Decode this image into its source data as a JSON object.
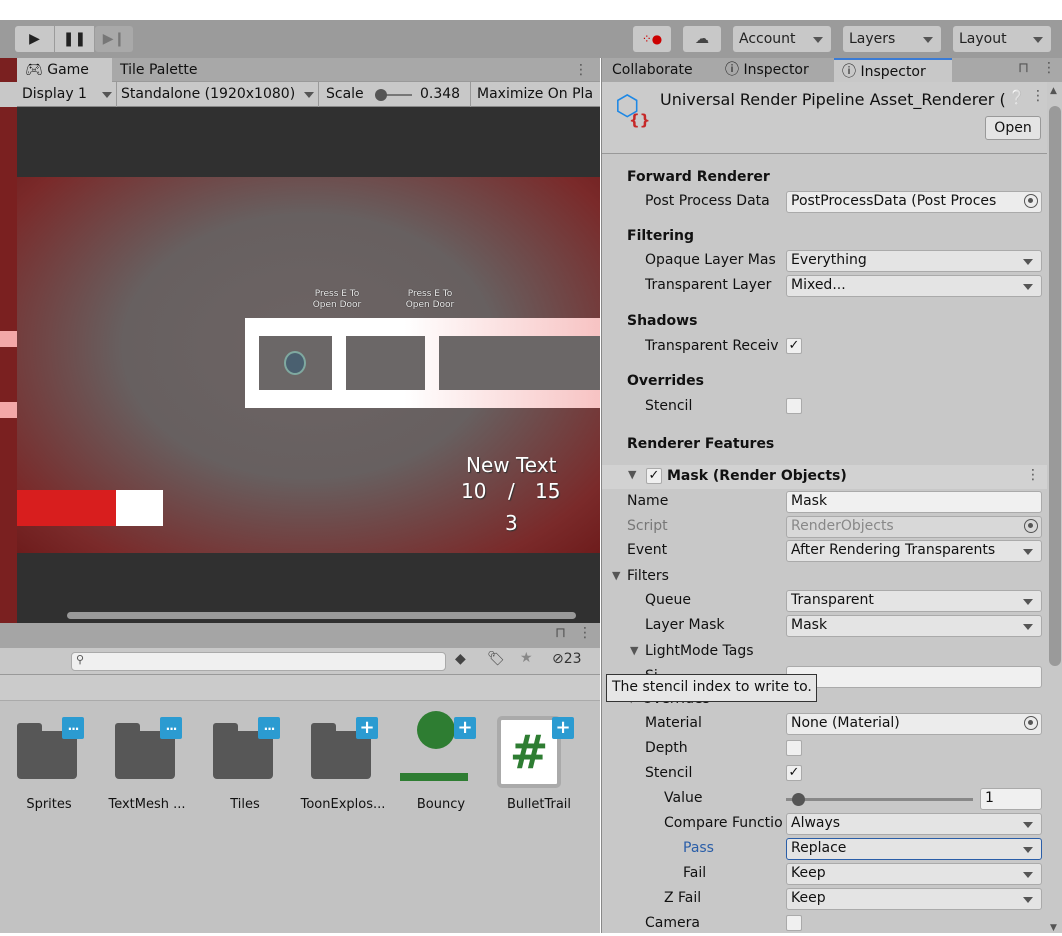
{
  "toolbar": {
    "account": "Account",
    "layers": "Layers",
    "layout": "Layout"
  },
  "game": {
    "tabs": [
      "Game",
      "Tile Palette"
    ],
    "display": "Display 1",
    "resolution": "Standalone (1920x1080)",
    "scale_label": "Scale",
    "scale_value": "0.348",
    "maximize": "Maximize On Pla",
    "hints": [
      "Press E To\nOpen Door",
      "Press E To\nOpen Door"
    ],
    "hud": {
      "title": "New Text",
      "count": "10",
      "slash": "/",
      "total": "15",
      "number": "3"
    },
    "health_fraction": 0.68
  },
  "project": {
    "hidden_count": "23",
    "assets": [
      {
        "name": "Sprites",
        "type": "folder",
        "badge": "..."
      },
      {
        "name": "TextMesh ...",
        "type": "folder",
        "badge": "..."
      },
      {
        "name": "Tiles",
        "type": "folder",
        "badge": "..."
      },
      {
        "name": "ToonExplos...",
        "type": "folder",
        "badge": "+"
      },
      {
        "name": "Bouncy",
        "type": "physics-material",
        "badge": "+"
      },
      {
        "name": "BulletTrail",
        "type": "script",
        "badge": "+"
      }
    ]
  },
  "inspector": {
    "tabs": [
      "Collaborate",
      "Inspector",
      "Inspector"
    ],
    "title": "Universal Render Pipeline Asset_Renderer (",
    "open": "Open",
    "tooltip": "The stencil index to write to.",
    "fields": [
      {
        "kind": "header",
        "label": "Forward Renderer"
      },
      {
        "kind": "object",
        "label": "Post Process Data",
        "value": "PostProcessData (Post Proces"
      },
      {
        "kind": "header",
        "label": "Filtering"
      },
      {
        "kind": "dropdown",
        "label": "Opaque Layer Mas",
        "value": "Everything"
      },
      {
        "kind": "dropdown",
        "label": "Transparent Layer",
        "value": "Mixed..."
      },
      {
        "kind": "header",
        "label": "Shadows"
      },
      {
        "kind": "checkbox",
        "label": "Transparent Receiv",
        "checked": true
      },
      {
        "kind": "header",
        "label": "Overrides"
      },
      {
        "kind": "checkbox",
        "label": "Stencil",
        "checked": false
      },
      {
        "kind": "header",
        "label": "Renderer Features"
      },
      {
        "kind": "feature",
        "label": "Mask (Render Objects)",
        "checked": true
      },
      {
        "kind": "text",
        "label": "Name",
        "value": "Mask"
      },
      {
        "kind": "object",
        "label": "Script",
        "value": "RenderObjects",
        "disabled": true
      },
      {
        "kind": "dropdown",
        "label": "Event",
        "value": "After Rendering Transparents"
      },
      {
        "kind": "foldout",
        "label": "Filters"
      },
      {
        "kind": "dropdown",
        "label": "Queue",
        "value": "Transparent"
      },
      {
        "kind": "dropdown",
        "label": "Layer Mask",
        "value": "Mask"
      },
      {
        "kind": "foldout",
        "label": "LightMode Tags"
      },
      {
        "kind": "text",
        "label": "Si",
        "value": ""
      },
      {
        "kind": "foldout",
        "label": "Overrides"
      },
      {
        "kind": "object",
        "label": "Material",
        "value": "None (Material)"
      },
      {
        "kind": "checkbox",
        "label": "Depth",
        "checked": false
      },
      {
        "kind": "checkbox",
        "label": "Stencil",
        "checked": true
      },
      {
        "kind": "slider",
        "label": "Value",
        "value": "1",
        "fraction": 0.0
      },
      {
        "kind": "dropdown",
        "label": "Compare Functio",
        "value": "Always"
      },
      {
        "kind": "dropdown",
        "label": "Pass",
        "value": "Replace",
        "focused": true
      },
      {
        "kind": "dropdown",
        "label": "Fail",
        "value": "Keep"
      },
      {
        "kind": "dropdown",
        "label": "Z Fail",
        "value": "Keep"
      },
      {
        "kind": "checkbox",
        "label": "Camera",
        "checked": false
      }
    ]
  },
  "colors": {
    "accent": "#2b9bd1",
    "focus": "#2a5ea8",
    "hud_red": "#d81e1e",
    "asset_green": "#2e7d32"
  }
}
